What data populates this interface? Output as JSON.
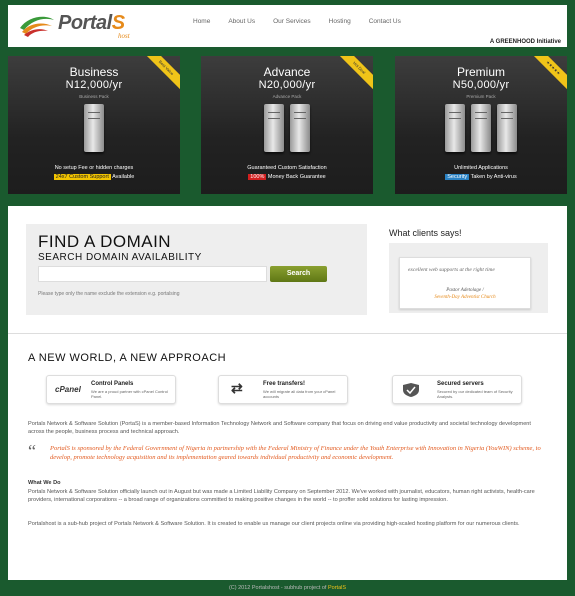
{
  "header": {
    "brand": "Portal",
    "brand_suffix": "S",
    "brand_sub": "host",
    "nav": [
      "Home",
      "About Us",
      "Our Services",
      "Hosting",
      "Contact Us"
    ],
    "tagline": "A GREENHOOD Initiative"
  },
  "plans": [
    {
      "name": "Business",
      "price": "N12,000/yr",
      "pack": "Business Pack",
      "servers": 1,
      "feat1": "No setup Fee or hidden charges",
      "feat2_highlight": "24x7 Custom Support",
      "feat2_rest": "Available",
      "highlight_color": "#f2c400",
      "ribbon": "Best Value"
    },
    {
      "name": "Advance",
      "price": "N20,000/yr",
      "pack": "Advance Pack",
      "servers": 2,
      "feat1": "Guaranteed Custom Satisfaction",
      "feat2_highlight": "100%",
      "feat2_rest": "Money Back Guarantee",
      "highlight_color": "#d21f1f",
      "ribbon": "Hot Deal"
    },
    {
      "name": "Premium",
      "price": "N50,000/yr",
      "pack": "Premium Pack",
      "servers": 3,
      "feat1": "Unlimited Applications",
      "feat2_highlight": "Security",
      "feat2_rest": "Taken by Anti-virus",
      "highlight_color": "#2a82c4",
      "ribbon": "★★★★★"
    }
  ],
  "domain": {
    "title": "FIND A DOMAIN",
    "subtitle": "SEARCH DOMAIN AVAILABILITY",
    "search_label": "Search",
    "hint": "Please type only the name exclude the extension e.g. portalsing"
  },
  "clients": {
    "title": "What clients says!",
    "quote": "excellent web supports at the right time",
    "author": "Pastor Adetolage /",
    "org": "Seventh-Day Adventist Church"
  },
  "approach": {
    "title": "A NEW WORLD, A NEW APPROACH",
    "features": [
      {
        "icon": "cpanel-icon",
        "icon_text": "cPanel",
        "title": "Control Panels",
        "desc": "We are a proud partner with cPanel Control Panel."
      },
      {
        "icon": "transfer-icon",
        "icon_text": "⇄",
        "title": "Free transfers!",
        "desc": "We will migrate all data from your cPanel accounts"
      },
      {
        "icon": "shield-icon",
        "icon_text": "",
        "title": "Secured servers",
        "desc": "Secured by our dedicated team of Security Analysts."
      }
    ]
  },
  "content": {
    "intro": "Portals Network & Software Solution (PortaS) is a member-based Information Technology Network and Software company that focus on driving end value productivity and societal technology development across the people, business process and technical approach.",
    "quote": "PortalS is sponsored by the Federal Government of Nigeria in partnership with the Federal Ministry of Finance under the Youth Enterprise with Innovation in Nigeria (YouWIN) scheme, to develop, promote technology acquisition and its implementation geared towards individual productivity and economic development.",
    "what_we_do_title": "What We Do",
    "what_we_do": "Portals Network & Software Solution officially launch out in August but was made a Limited Liability Company on September 2012. We've worked with journalist, educators, human right activists, health-care providers, international corporations -- a broad range of organizations committed to making positive changes in the world -- to proffer solid solutions for lasting impression.",
    "closing": "Portalshost is a sub-hub project of Portals Network & Software Solution. It is created to enable us manage our client projects online via providing high-scaled hosting platform for our numerous clients."
  },
  "footer": {
    "text": "(C) 2012 Portalshost - subhub project of",
    "accent": "PortalS"
  }
}
